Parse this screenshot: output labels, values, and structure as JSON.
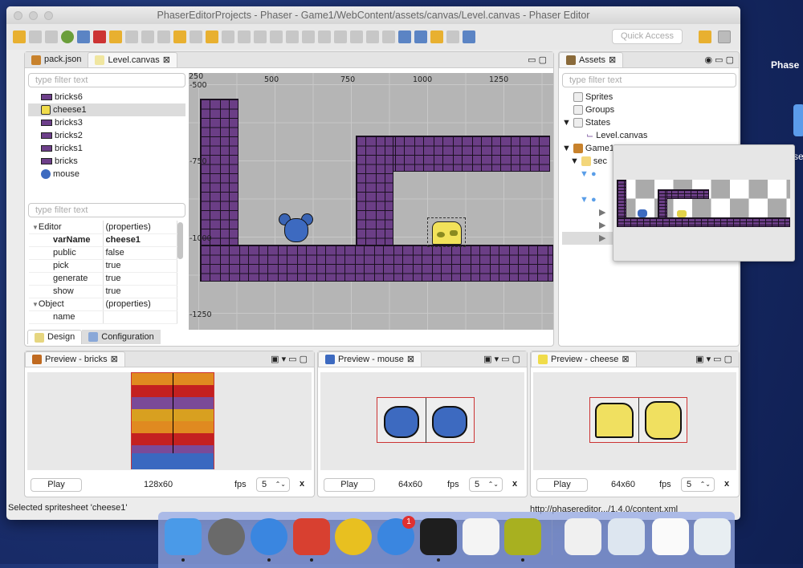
{
  "window": {
    "title": "PhaserEditorProjects - Phaser - Game1/WebContent/assets/canvas/Level.canvas - Phaser Editor",
    "quick_access": "Quick Access"
  },
  "editor": {
    "tabs": [
      {
        "label": "pack.json"
      },
      {
        "label": "Level.canvas"
      }
    ],
    "outline_filter_placeholder": "type filter text",
    "outline": [
      {
        "label": "bricks6",
        "icon": "bricks-icon"
      },
      {
        "label": "cheese1",
        "icon": "cheese-icon",
        "selected": true
      },
      {
        "label": "bricks3",
        "icon": "bricks-icon"
      },
      {
        "label": "bricks2",
        "icon": "bricks-icon"
      },
      {
        "label": "bricks1",
        "icon": "bricks-icon"
      },
      {
        "label": "bricks",
        "icon": "bricks-icon"
      },
      {
        "label": "mouse",
        "icon": "mouse-icon"
      }
    ],
    "props_filter_placeholder": "type filter text",
    "properties": [
      {
        "k": "Editor",
        "v": "(properties)",
        "group": true
      },
      {
        "k": "varName",
        "v": "cheese1",
        "bold": true
      },
      {
        "k": "public",
        "v": "false"
      },
      {
        "k": "pick",
        "v": "true"
      },
      {
        "k": "generate",
        "v": "true"
      },
      {
        "k": "show",
        "v": "true"
      },
      {
        "k": "Object",
        "v": "(properties)",
        "group": true
      },
      {
        "k": "name",
        "v": ""
      }
    ],
    "bottom_tabs": [
      {
        "label": "Design"
      },
      {
        "label": "Configuration"
      }
    ],
    "ruler_x": [
      "250",
      "500",
      "750",
      "1000",
      "1250"
    ],
    "ruler_y": [
      "-500",
      "-750",
      "-1000",
      "-1250"
    ]
  },
  "assets": {
    "title": "Assets",
    "filter_placeholder": "type filter text",
    "tree": [
      {
        "label": "Sprites"
      },
      {
        "label": "Groups"
      },
      {
        "label": "States"
      },
      {
        "label": "Level.canvas"
      },
      {
        "label": "Game1"
      },
      {
        "label": "sec"
      }
    ]
  },
  "previews": [
    {
      "title": "Preview - bricks",
      "play": "Play",
      "size": "128x60",
      "fps_label": "fps",
      "fps": "5",
      "close": "x"
    },
    {
      "title": "Preview - mouse",
      "play": "Play",
      "size": "64x60",
      "fps_label": "fps",
      "fps": "5",
      "close": "x"
    },
    {
      "title": "Preview - cheese",
      "play": "Play",
      "size": "64x60",
      "fps_label": "fps",
      "fps": "5",
      "close": "x"
    }
  ],
  "status": {
    "left": "Selected spritesheet 'cheese1'",
    "right": "http://phasereditor.../1.4.0/content.xml"
  },
  "desktop": {
    "label1": "Phase",
    "label2": "se"
  },
  "dock": {
    "badge": "1",
    "apps": [
      "finder",
      "launchpad",
      "safari",
      "remote-desktop",
      "chrome",
      "app-store",
      "terminal",
      "textedit",
      "phaser-editor",
      "xlsx-file",
      "screenshot",
      "document",
      "trash"
    ]
  },
  "colors": {
    "brick": "#6b3e86",
    "selection": "#dcdcdc",
    "canvas_bg": "#b5b5b5"
  }
}
